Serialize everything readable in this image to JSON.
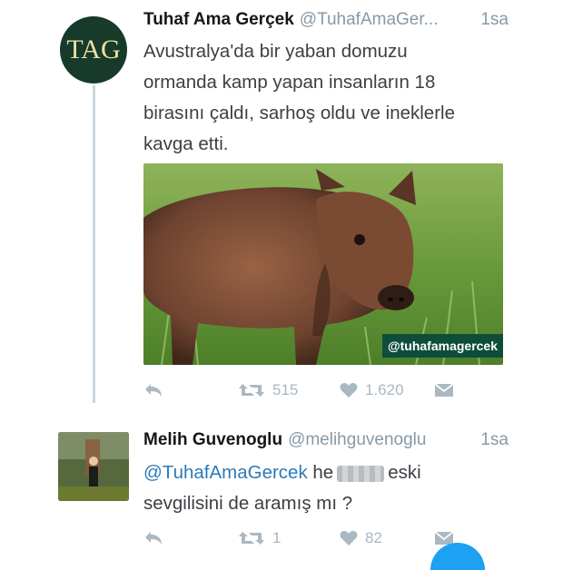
{
  "tweet1": {
    "avatar_text": "TAG",
    "display_name": "Tuhaf Ama Gerçek",
    "handle": "@TuhafAmaGer...",
    "time": "1sa",
    "text_lines": [
      "Avustralya'da bir yaban domuzu",
      "ormanda kamp yapan insanların 18",
      "birasını çaldı, sarhoş oldu ve ineklerle",
      "kavga etti."
    ],
    "image_watermark": "@tuhafamagercek",
    "retweets": "515",
    "likes": "1.620"
  },
  "tweet2": {
    "display_name": "Melih Guvenoglu",
    "handle": "@melihguvenoglu",
    "time": "1sa",
    "mention": "@TuhafAmaGercek",
    "text_he": "he",
    "text_after": "eski",
    "text_line2": "sevgilisini de aramış mı ?",
    "retweets": "1",
    "likes": "82"
  },
  "icons": [
    "reply-icon",
    "retweet-icon",
    "heart-icon",
    "dm-icon"
  ],
  "colors": {
    "link": "#2b7bb9",
    "muted": "#aab8c2",
    "avatar_bg": "#173a2a",
    "accent": "#1da1f2"
  }
}
